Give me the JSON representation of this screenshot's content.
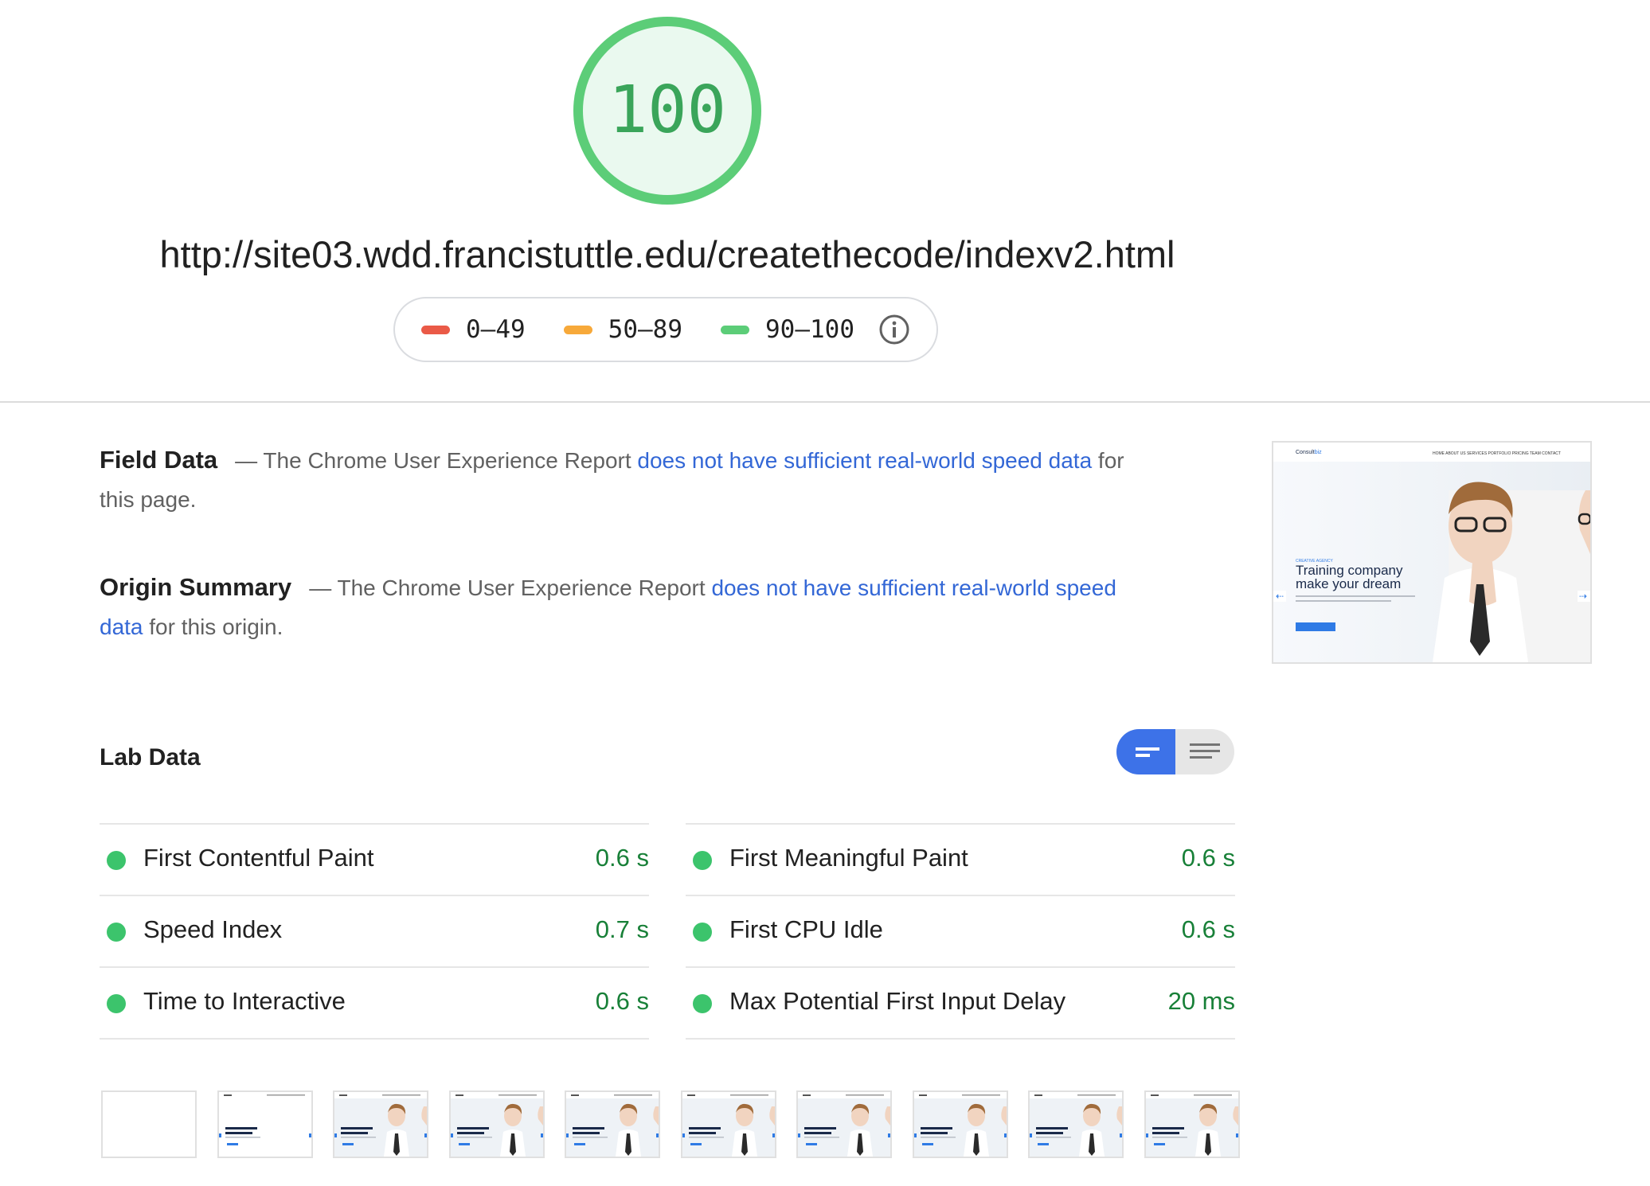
{
  "score": {
    "value": "100",
    "color": "#0cce6b"
  },
  "url": "http://site03.wdd.francistuttle.edu/createthecode/indexv2.html",
  "legend": [
    {
      "range": "0–49",
      "color": "#ea5a47"
    },
    {
      "range": "50–89",
      "color": "#f7a93a"
    },
    {
      "range": "90–100",
      "color": "#5ccd78"
    }
  ],
  "field_data": {
    "title": "Field Data",
    "dash_text": "— The Chrome User Experience Report",
    "link_text": "does not have sufficient real-world speed data",
    "suffix": "for this page."
  },
  "origin_summary": {
    "title": "Origin Summary",
    "dash_text": "— The Chrome User Experience Report",
    "link_text": "does not have sufficient real-world speed data",
    "suffix": "for this origin."
  },
  "thumbnail": {
    "brand": "Consult",
    "brand_accent": "biz",
    "nav": "HOME  ABOUT US  SERVICES  PORTFOLIO  PRICING  TEAM  CONTACT",
    "eyebrow": "CREATIVE AGENCY",
    "headline_1": "Training company",
    "headline_2": "make your dream"
  },
  "lab_data": {
    "title": "Lab Data",
    "toggle_state": "bars",
    "metrics_left": [
      {
        "label": "First Contentful Paint",
        "value": "0.6 s",
        "status": "pass"
      },
      {
        "label": "Speed Index",
        "value": "0.7 s",
        "status": "pass"
      },
      {
        "label": "Time to Interactive",
        "value": "0.6 s",
        "status": "pass"
      }
    ],
    "metrics_right": [
      {
        "label": "First Meaningful Paint",
        "value": "0.6 s",
        "status": "pass"
      },
      {
        "label": "First CPU Idle",
        "value": "0.6 s",
        "status": "pass"
      },
      {
        "label": "Max Potential First Input Delay",
        "value": "20 ms",
        "status": "pass"
      }
    ]
  },
  "filmstrip": {
    "frame_count": 10,
    "blank_frames": 1,
    "partial_frames": 1
  }
}
